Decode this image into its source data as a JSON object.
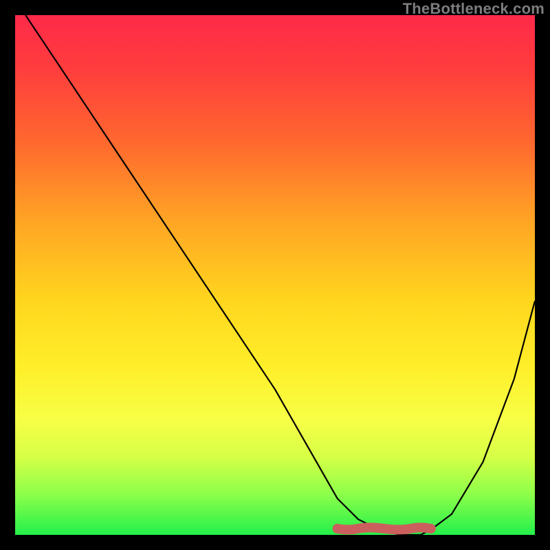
{
  "brand": "TheBottleneck.com",
  "chart_data": {
    "type": "line",
    "title": "",
    "xlabel": "",
    "ylabel": "",
    "xlim": [
      0,
      100
    ],
    "ylim": [
      0,
      100
    ],
    "series": [
      {
        "name": "curve",
        "x": [
          2,
          10,
          20,
          30,
          40,
          50,
          58,
          62,
          66,
          70,
          74,
          78,
          80,
          84,
          90,
          96,
          100
        ],
        "y": [
          100,
          88,
          73,
          58,
          43,
          28,
          14,
          7,
          3,
          1,
          0,
          0,
          1,
          4,
          14,
          30,
          45
        ]
      }
    ],
    "flat_region": {
      "x_start": 62,
      "x_end": 80,
      "y": 1.2
    },
    "flat_marker_color": "#cb5f5d",
    "flat_marker_radius": 7
  }
}
